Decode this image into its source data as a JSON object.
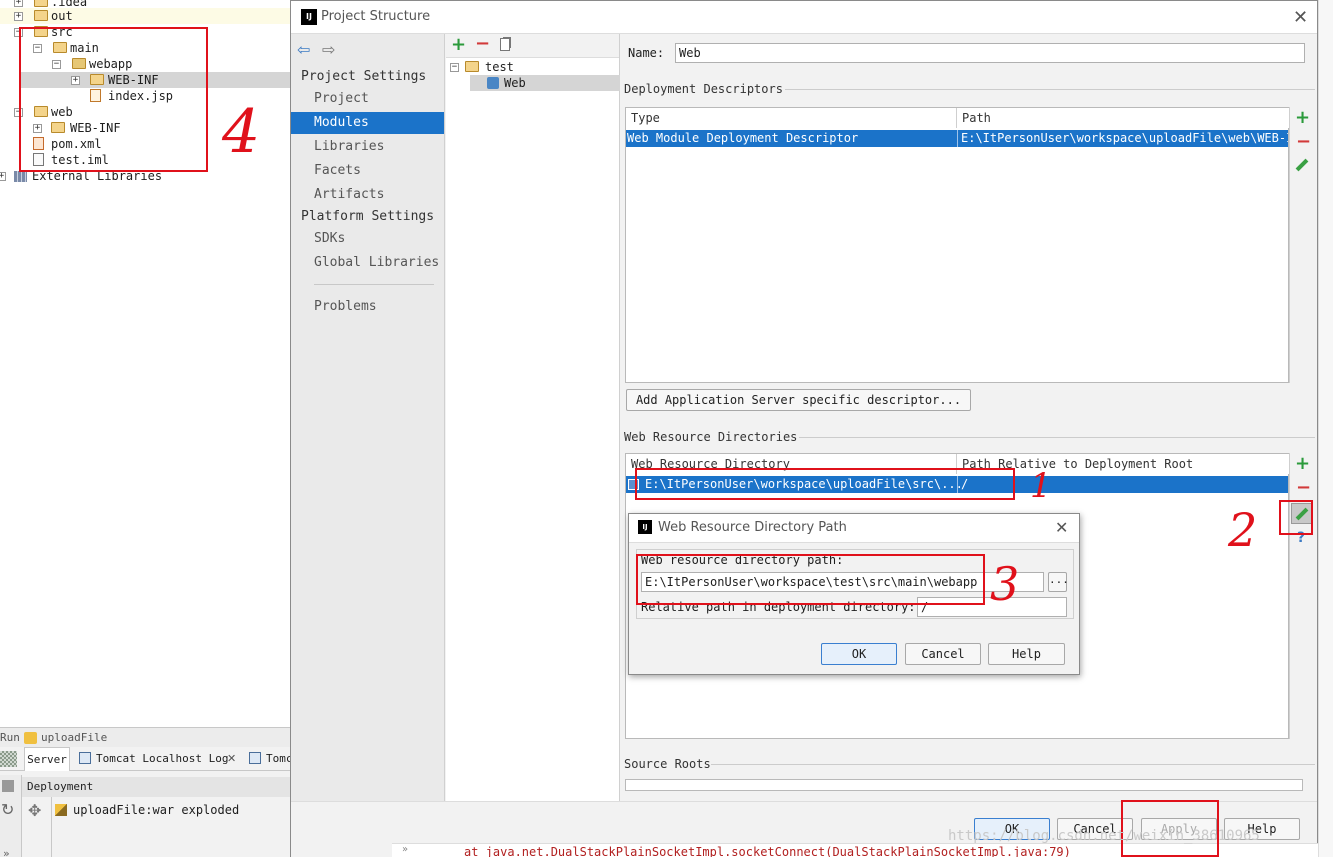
{
  "project_tree": {
    "items": [
      {
        "label": ".idea",
        "level": 0
      },
      {
        "label": "out",
        "level": 0
      },
      {
        "label": "src",
        "level": 0
      },
      {
        "label": "main",
        "level": 1
      },
      {
        "label": "webapp",
        "level": 2
      },
      {
        "label": "WEB-INF",
        "level": 3
      },
      {
        "label": "index.jsp",
        "level": 3
      },
      {
        "label": "web",
        "level": 0
      },
      {
        "label": "WEB-INF",
        "level": 1
      },
      {
        "label": "pom.xml",
        "level": 0
      },
      {
        "label": "test.iml",
        "level": 0
      },
      {
        "label": "External Libraries",
        "level": 0
      }
    ]
  },
  "run_panel": {
    "run_label": "Run",
    "config_name": "uploadFile",
    "tabs": [
      "Server",
      "Tomcat Localhost Log",
      "Tomc"
    ],
    "deployment_header": "Deployment",
    "deployment_item": "uploadFile:war exploded",
    "console_line": "at java.net.DualStackPlainSocketImpl.socketConnect(DualStackPlainSocketImpl.java:79)"
  },
  "dialog": {
    "title": "Project Structure",
    "logo": "IJ",
    "nav": {
      "project_settings_header": "Project Settings",
      "project_settings": [
        "Project",
        "Modules",
        "Libraries",
        "Facets",
        "Artifacts"
      ],
      "platform_settings_header": "Platform Settings",
      "platform_settings": [
        "SDKs",
        "Global Libraries"
      ],
      "problems": "Problems",
      "selected": "Modules"
    },
    "module_tree": {
      "root": "test",
      "child": "Web"
    },
    "name_label": "Name:",
    "name_value": "Web",
    "deployment_descriptors": {
      "header": "Deployment Descriptors",
      "columns": [
        "Type",
        "Path"
      ],
      "rows": [
        {
          "type": "Web Module Deployment Descriptor",
          "path": "E:\\ItPersonUser\\workspace\\uploadFile\\web\\WEB-IN"
        }
      ],
      "add_button": "Add Application Server specific descriptor..."
    },
    "web_resource_directories": {
      "header": "Web Resource Directories",
      "columns": [
        "Web Resource Directory",
        "Path Relative to Deployment Root"
      ],
      "rows": [
        {
          "dir": "E:\\ItPersonUser\\workspace\\uploadFile\\src\\...",
          "rel": "/"
        }
      ]
    },
    "source_roots_header": "Source Roots",
    "buttons": {
      "ok": "OK",
      "cancel": "Cancel",
      "apply": "Apply",
      "help": "Help"
    }
  },
  "sub_dialog": {
    "title": "Web Resource Directory Path",
    "logo": "IJ",
    "dir_label": "Web resource directory path:",
    "dir_value": "E:\\ItPersonUser\\workspace\\test\\src\\main\\webapp",
    "browse": "...",
    "rel_label": "Relative path in deployment directory:",
    "rel_value": "/",
    "buttons": {
      "ok": "OK",
      "cancel": "Cancel",
      "help": "Help"
    }
  },
  "annotations": {
    "n1": "1",
    "n2": "2",
    "n3": "3",
    "n4": "4"
  },
  "watermark": "https://blog.csdn.net/weixin_38610965",
  "colors": {
    "selection": "#1b73c9",
    "annotation": "#e0111b",
    "add": "#2b9a3b",
    "remove": "#d23a3a"
  }
}
